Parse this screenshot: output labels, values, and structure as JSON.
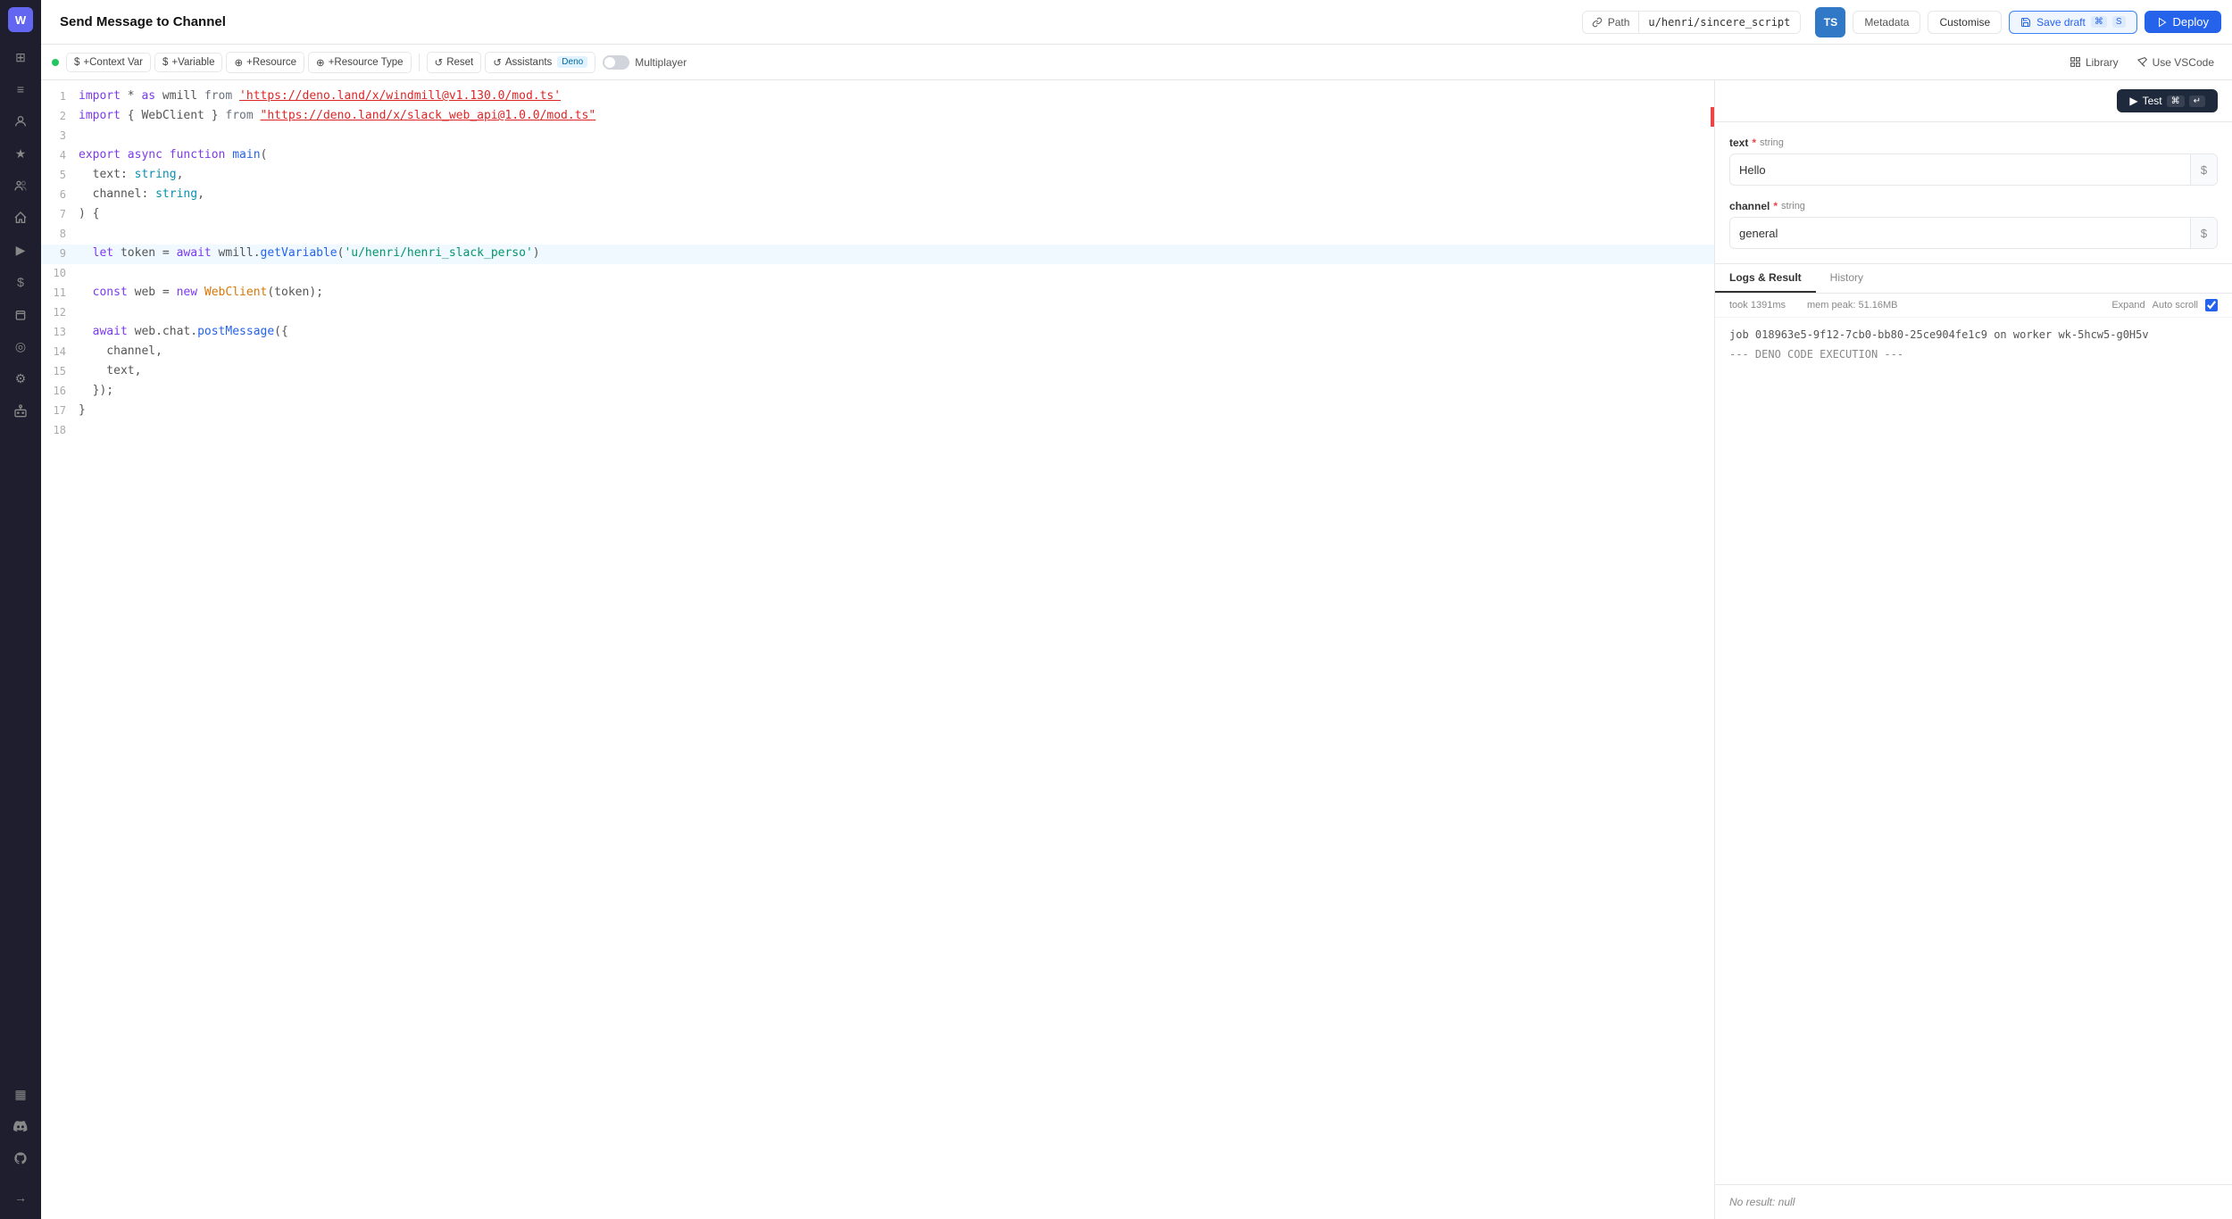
{
  "sidebar": {
    "logo": "W",
    "icons": [
      {
        "name": "home",
        "symbol": "⊞",
        "active": false
      },
      {
        "name": "activity",
        "symbol": "📊",
        "active": false
      },
      {
        "name": "user",
        "symbol": "👤",
        "active": false
      },
      {
        "name": "star",
        "symbol": "★",
        "active": false
      },
      {
        "name": "users",
        "symbol": "👥",
        "active": false
      },
      {
        "name": "house",
        "symbol": "🏠",
        "active": false
      },
      {
        "name": "play",
        "symbol": "▶",
        "active": false
      },
      {
        "name": "dollar",
        "symbol": "$",
        "active": false
      },
      {
        "name": "puzzle",
        "symbol": "🧩",
        "active": false
      },
      {
        "name": "eye",
        "symbol": "◎",
        "active": false
      },
      {
        "name": "settings",
        "symbol": "⚙",
        "active": false
      },
      {
        "name": "bot",
        "symbol": "🤖",
        "active": false
      },
      {
        "name": "table",
        "symbol": "▦",
        "active": false
      },
      {
        "name": "discord",
        "symbol": "💬",
        "active": false
      },
      {
        "name": "github",
        "symbol": "⬡",
        "active": false
      }
    ],
    "bottom_icon": {
      "name": "arrow-right",
      "symbol": "→"
    }
  },
  "topbar": {
    "title": "Send Message to Channel",
    "path_label": "Path",
    "path_value": "u/henri/sincere_script",
    "ts_badge": "TS",
    "metadata_label": "Metadata",
    "customise_label": "Customise",
    "save_label": "Save draft",
    "save_kbd1": "⌘",
    "save_kbd2": "S",
    "deploy_label": "Deploy"
  },
  "toolbar": {
    "context_var_label": "+Context Var",
    "variable_label": "+Variable",
    "resource_label": "+Resource",
    "resource_type_label": "+Resource Type",
    "reset_label": "Reset",
    "assistants_label": "Assistants",
    "assistants_badge": "Deno",
    "multiplayer_label": "Multiplayer",
    "library_label": "Library",
    "vscode_label": "Use VSCode"
  },
  "editor": {
    "lines": [
      {
        "num": 1,
        "tokens": [
          {
            "t": "kw",
            "v": "import"
          },
          {
            "t": "punct",
            "v": " * "
          },
          {
            "t": "kw",
            "v": "as"
          },
          {
            "t": "punct",
            "v": " wmill "
          },
          {
            "t": "cm",
            "v": "from"
          },
          {
            "t": "punct",
            "v": " "
          },
          {
            "t": "str",
            "v": "'https://deno.land/x/windmill@v1.130.0/mod.ts'"
          }
        ]
      },
      {
        "num": 2,
        "tokens": [
          {
            "t": "kw",
            "v": "import"
          },
          {
            "t": "punct",
            "v": " { WebClient } "
          },
          {
            "t": "cm",
            "v": "from"
          },
          {
            "t": "punct",
            "v": " "
          },
          {
            "t": "str2",
            "v": "\"https://deno.land/x/slack_web_api@1.0.0/mod.ts\""
          }
        ],
        "has_error": true
      },
      {
        "num": 3,
        "tokens": []
      },
      {
        "num": 4,
        "tokens": [
          {
            "t": "kw",
            "v": "export"
          },
          {
            "t": "punct",
            "v": " "
          },
          {
            "t": "kw",
            "v": "async"
          },
          {
            "t": "punct",
            "v": " "
          },
          {
            "t": "kw",
            "v": "function"
          },
          {
            "t": "punct",
            "v": " "
          },
          {
            "t": "fn",
            "v": "main"
          },
          {
            "t": "punct",
            "v": "("
          }
        ]
      },
      {
        "num": 5,
        "tokens": [
          {
            "t": "punct",
            "v": "  text: "
          },
          {
            "t": "type",
            "v": "string"
          },
          {
            "t": "punct",
            "v": ","
          }
        ]
      },
      {
        "num": 6,
        "tokens": [
          {
            "t": "punct",
            "v": "  channel: "
          },
          {
            "t": "type",
            "v": "string"
          },
          {
            "t": "punct",
            "v": ","
          }
        ]
      },
      {
        "num": 7,
        "tokens": [
          {
            "t": "punct",
            "v": ") {"
          }
        ]
      },
      {
        "num": 8,
        "tokens": []
      },
      {
        "num": 9,
        "tokens": [
          {
            "t": "punct",
            "v": "  "
          },
          {
            "t": "kw",
            "v": "let"
          },
          {
            "t": "punct",
            "v": " token = "
          },
          {
            "t": "kw",
            "v": "await"
          },
          {
            "t": "punct",
            "v": " wmill."
          },
          {
            "t": "fn",
            "v": "getVariable"
          },
          {
            "t": "punct",
            "v": "("
          },
          {
            "t": "var",
            "v": "'u/henri/henri_slack_perso'"
          },
          {
            "t": "punct",
            "v": ")"
          }
        ],
        "active": true
      },
      {
        "num": 10,
        "tokens": []
      },
      {
        "num": 11,
        "tokens": [
          {
            "t": "punct",
            "v": "  "
          },
          {
            "t": "kw",
            "v": "const"
          },
          {
            "t": "punct",
            "v": " web = "
          },
          {
            "t": "kw",
            "v": "new"
          },
          {
            "t": "punct",
            "v": " "
          },
          {
            "t": "obj",
            "v": "WebClient"
          },
          {
            "t": "punct",
            "v": "(token);"
          }
        ]
      },
      {
        "num": 12,
        "tokens": []
      },
      {
        "num": 13,
        "tokens": [
          {
            "t": "punct",
            "v": "  "
          },
          {
            "t": "kw",
            "v": "await"
          },
          {
            "t": "punct",
            "v": " web.chat."
          },
          {
            "t": "fn",
            "v": "postMessage"
          },
          {
            "t": "punct",
            "v": "({"
          }
        ]
      },
      {
        "num": 14,
        "tokens": [
          {
            "t": "punct",
            "v": "    channel,"
          }
        ]
      },
      {
        "num": 15,
        "tokens": [
          {
            "t": "punct",
            "v": "    text,"
          }
        ]
      },
      {
        "num": 16,
        "tokens": [
          {
            "t": "punct",
            "v": "  });"
          }
        ]
      },
      {
        "num": 17,
        "tokens": [
          {
            "t": "punct",
            "v": "}"
          }
        ]
      },
      {
        "num": 18,
        "tokens": []
      }
    ]
  },
  "right_panel": {
    "test_label": "Test",
    "test_kbd1": "⌘",
    "test_kbd2": "↵",
    "fields": [
      {
        "id": "text",
        "label": "text",
        "required": true,
        "type_hint": "string",
        "value": "Hello",
        "placeholder": ""
      },
      {
        "id": "channel",
        "label": "channel",
        "required": true,
        "type_hint": "string",
        "value": "general",
        "placeholder": ""
      }
    ],
    "logs_tabs": [
      {
        "label": "Logs & Result",
        "active": true
      },
      {
        "label": "History",
        "active": false
      }
    ],
    "logs_meta": {
      "took": "took 1391ms",
      "mem_peak": "mem peak: 51.16MB",
      "expand_label": "Expand",
      "auto_scroll_label": "Auto scroll"
    },
    "logs_content": {
      "job_line": "job 018963e5-9f12-7cb0-bb80-25ce904fe1c9 on worker wk-5hcw5-g0H5v",
      "deno_line": "--- DENO CODE EXECUTION ---"
    },
    "result_label": "No result: null"
  }
}
